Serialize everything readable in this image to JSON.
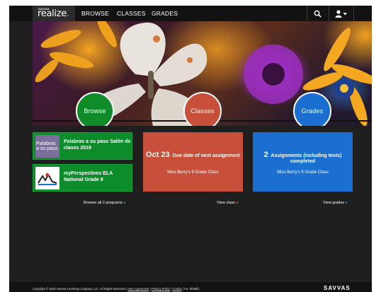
{
  "nav": {
    "logo_small": "SAVVAS",
    "logo_main": "realize",
    "logo_dot": ".",
    "items": [
      "BROWSE",
      "CLASSES",
      "GRADES"
    ],
    "search_icon": "search-icon",
    "user_icon": "user-dropdown-icon"
  },
  "hero": {
    "buttons": [
      {
        "label": "Browse",
        "color": "#0f8b2a"
      },
      {
        "label": "Classes",
        "color": "#c8503a"
      },
      {
        "label": "Grades",
        "color": "#1a6fd0"
      }
    ]
  },
  "programs": [
    {
      "title": "Palabras a su paso Salón de clases 2019",
      "thumb_text": "Palabras a su paso"
    },
    {
      "title": "myPerspectives ELA National Grade 9",
      "thumb_text": "myPerspectives"
    }
  ],
  "browse_link": "Browse all 2 programs",
  "class_card": {
    "big": "Oct 23",
    "text": "Due date of next assignment",
    "sub": "Miss Berry's 9 Grade Class",
    "color": "#c8503a"
  },
  "class_link": "View class",
  "grades_card": {
    "big": "2",
    "text": "Assignments (including tests) completed",
    "sub": "Miss Berry's 9 Grade Class",
    "color": "#1a6fd0"
  },
  "grades_link": "View grades",
  "footer": {
    "copyright": "Copyright © 2020 Savvas Learning Company LLC. All Rights Reserved.",
    "user_agreement": "User Agreement",
    "privacy": "Privacy Policy",
    "credits": "Credits",
    "rev": "rev. 5f08dfc",
    "brand": "SAVVAS"
  }
}
